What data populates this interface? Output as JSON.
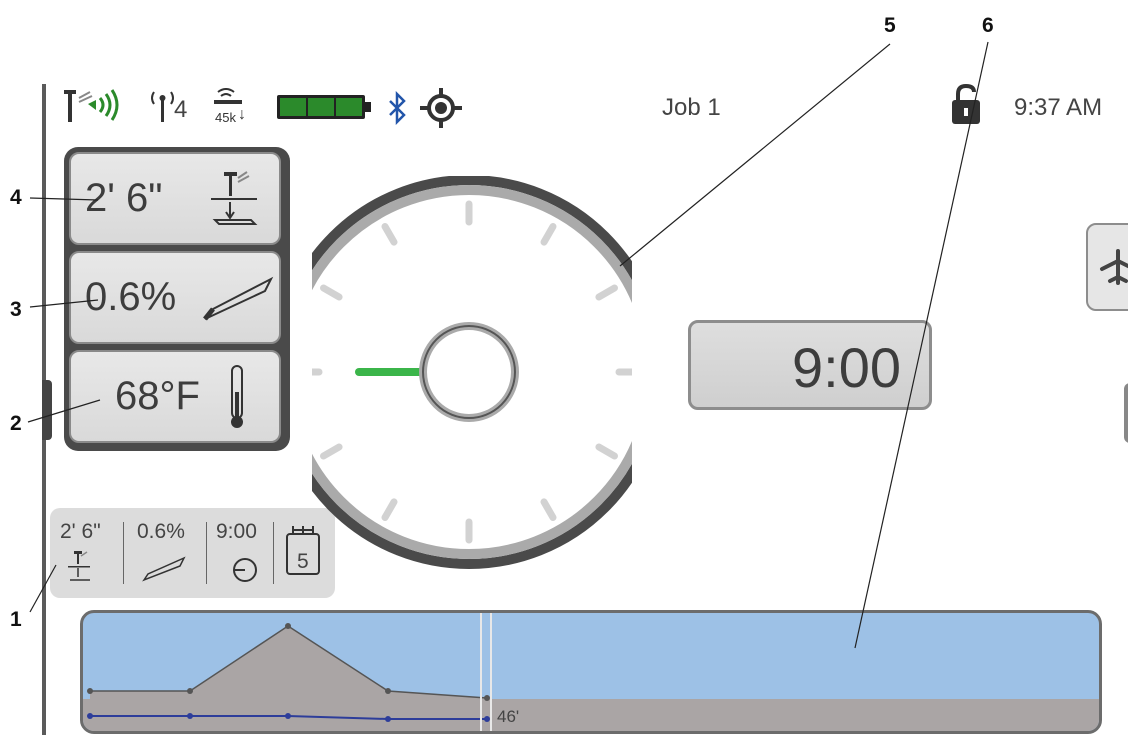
{
  "status_bar": {
    "signal_label": "4",
    "data_rate": "45k",
    "job_title": "Job 1",
    "clock": "9:37 AM",
    "battery_color": "#2b8a2b",
    "bluetooth_color": "#2255aa",
    "icons": [
      "beacon-signal-icon",
      "antenna-icon",
      "data-transfer-icon",
      "battery-icon",
      "bluetooth-icon",
      "gps-target-icon",
      "lock-icon"
    ]
  },
  "callouts": [
    "1",
    "2",
    "3",
    "4",
    "5",
    "6"
  ],
  "tiles": {
    "depth": "2' 6\"",
    "pitch": "0.6%",
    "temperature": "68°F"
  },
  "dial": {
    "roll_readout": "9:00",
    "needle_color": "#3bb54a"
  },
  "summary": {
    "depth": "2' 6\"",
    "pitch": "0.6%",
    "roll": "9:00",
    "rod_count": "5"
  },
  "profile": {
    "distance_label": "46'",
    "sky_color": "#9dc1e6",
    "ground_color": "#aaa5a5",
    "line_color": "#2d3d9a"
  }
}
